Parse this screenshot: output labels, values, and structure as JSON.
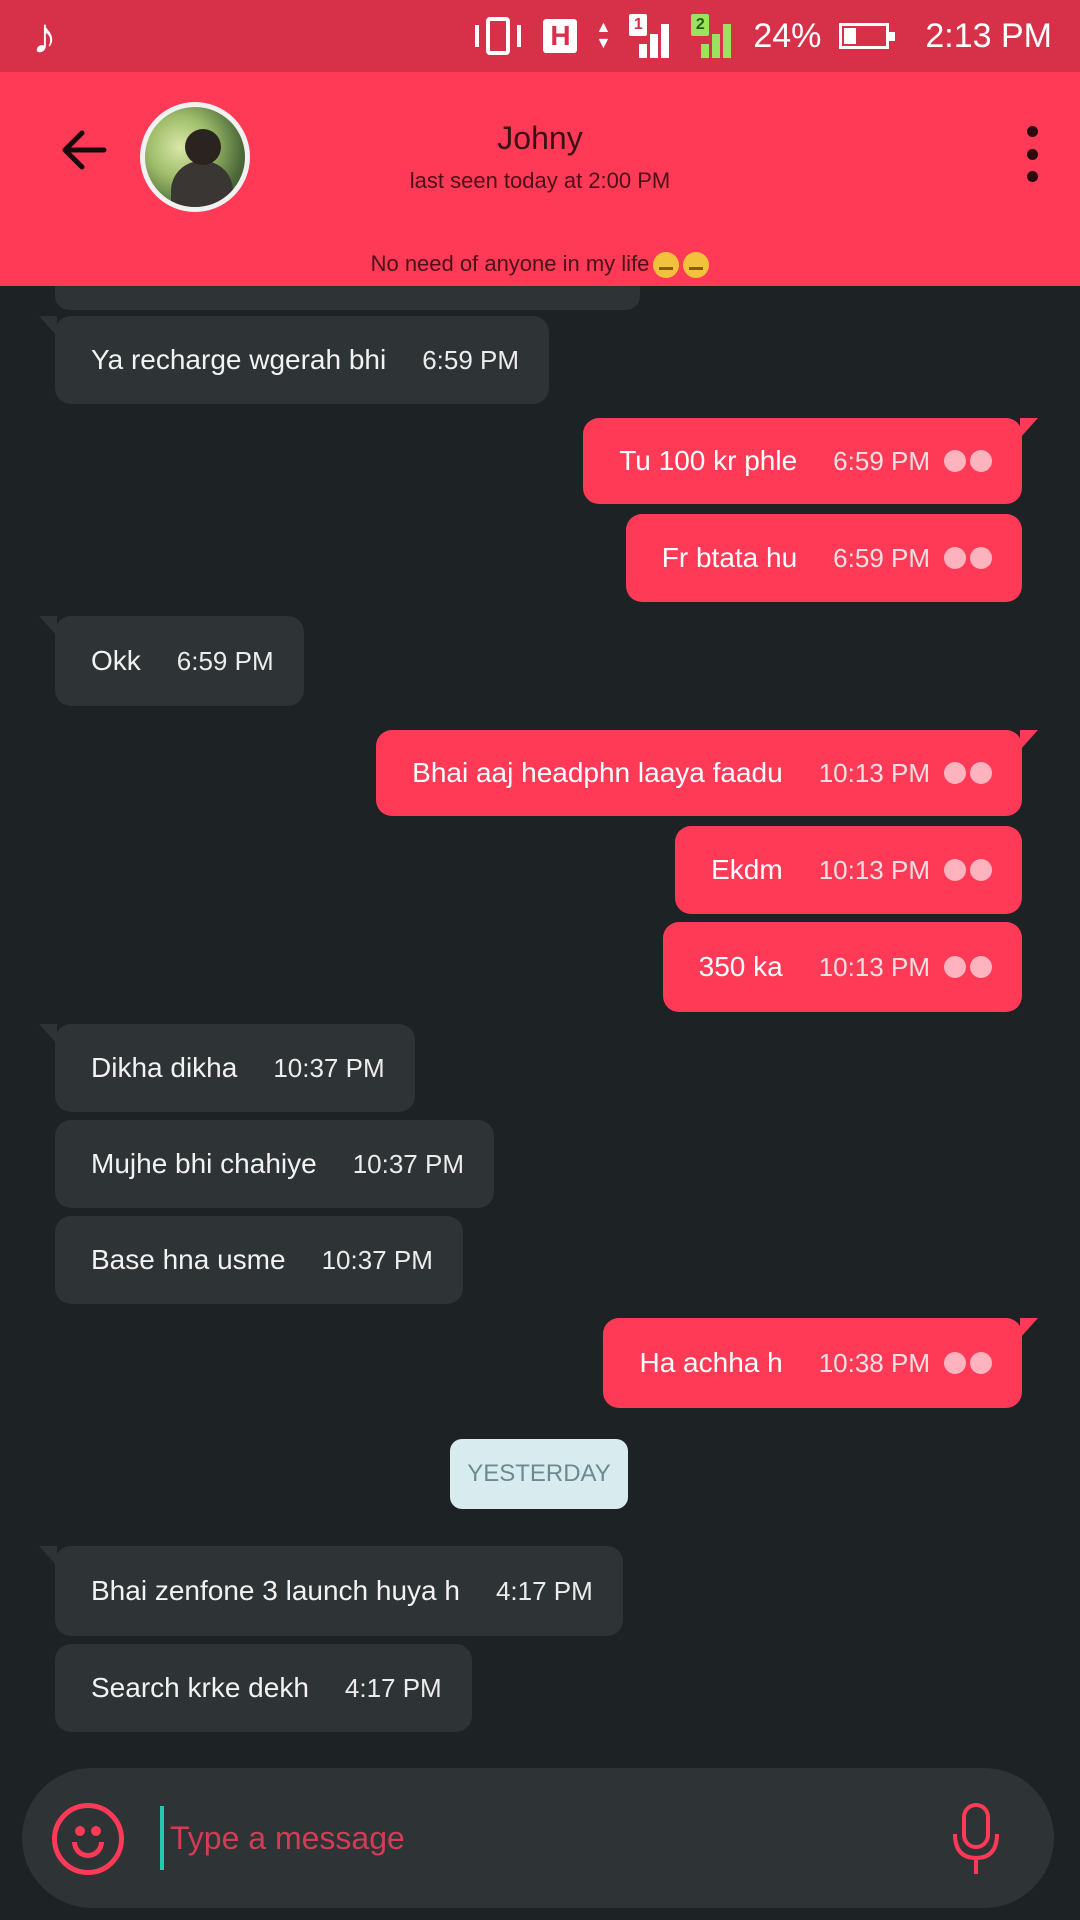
{
  "status_bar": {
    "battery": "24%",
    "time": "2:13 PM",
    "sim1": "1",
    "sim2": "2",
    "network": "H",
    "music_glyph": "♪"
  },
  "header": {
    "name": "Johny",
    "last_seen": "last seen today at 2:00 PM",
    "about": "No need of anyone in my life"
  },
  "messages": [
    {
      "dir": "in",
      "text": "Ya recharge wgerah bhi",
      "time": "6:59 PM"
    },
    {
      "dir": "out",
      "text": "Tu 100 kr phle",
      "time": "6:59 PM"
    },
    {
      "dir": "out",
      "text": "Fr btata hu",
      "time": "6:59 PM"
    },
    {
      "dir": "in",
      "text": "Okk",
      "time": "6:59 PM"
    },
    {
      "dir": "out",
      "text": "Bhai aaj headphn laaya faadu",
      "time": "10:13 PM"
    },
    {
      "dir": "out",
      "text": "Ekdm",
      "time": "10:13 PM"
    },
    {
      "dir": "out",
      "text": "350 ka",
      "time": "10:13 PM"
    },
    {
      "dir": "in",
      "text": "Dikha dikha",
      "time": "10:37 PM"
    },
    {
      "dir": "in",
      "text": "Mujhe bhi chahiye",
      "time": "10:37 PM"
    },
    {
      "dir": "in",
      "text": "Base hna usme",
      "time": "10:37 PM"
    },
    {
      "dir": "out",
      "text": "Ha achha h",
      "time": "10:38 PM"
    },
    {
      "dir": "in",
      "text": "Bhai zenfone 3 launch huya h",
      "time": "4:17 PM"
    },
    {
      "dir": "in",
      "text": "Search krke dekh",
      "time": "4:17 PM"
    }
  ],
  "date_divider": "YESTERDAY",
  "composer": {
    "placeholder": "Type a message"
  },
  "colors": {
    "accent": "#ff3a57",
    "status_bar": "#d7314a",
    "background": "#1d2224",
    "incoming_bubble": "#2e3335"
  },
  "icons": [
    "music-note-icon",
    "vibrate-icon",
    "network-h-icon",
    "signal-icon",
    "battery-icon",
    "back-arrow-icon",
    "menu-dots-icon",
    "emoji-icon",
    "mic-icon"
  ]
}
